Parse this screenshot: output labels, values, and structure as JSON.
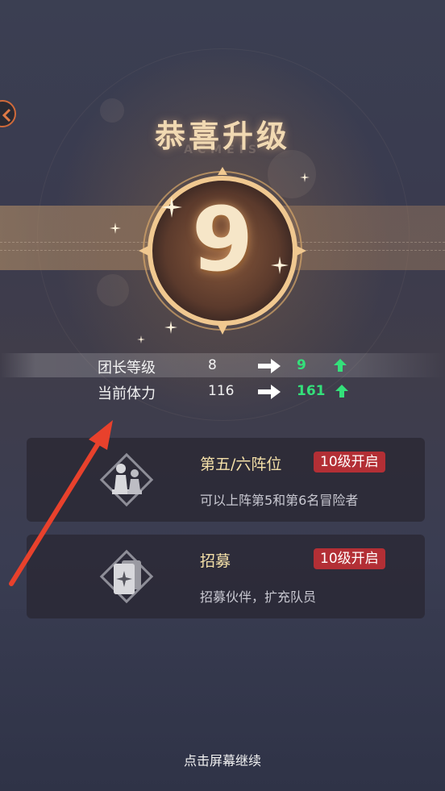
{
  "popup": {
    "title": "恭喜升级",
    "subtitle": "ACMEIS",
    "level": "9"
  },
  "stats": [
    {
      "label": "团长等级",
      "old": "8",
      "new": "9"
    },
    {
      "label": "当前体力",
      "old": "116",
      "new": "161"
    }
  ],
  "unlocks": [
    {
      "title": "第五/六阵位",
      "badge": "10级开启",
      "desc": "可以上阵第5和第6名冒险者",
      "icon": "chess-pawns-icon"
    },
    {
      "title": "招募",
      "badge": "10级开启",
      "desc": "招募伙伴，扩充队员",
      "icon": "recruit-card-icon"
    }
  ],
  "footer": {
    "hint": "点击屏幕继续"
  },
  "colors": {
    "gold": "#f1d9b2",
    "increase_green": "#34e07a",
    "badge_red": "#b32f35",
    "annotation_arrow": "#e8412c"
  }
}
